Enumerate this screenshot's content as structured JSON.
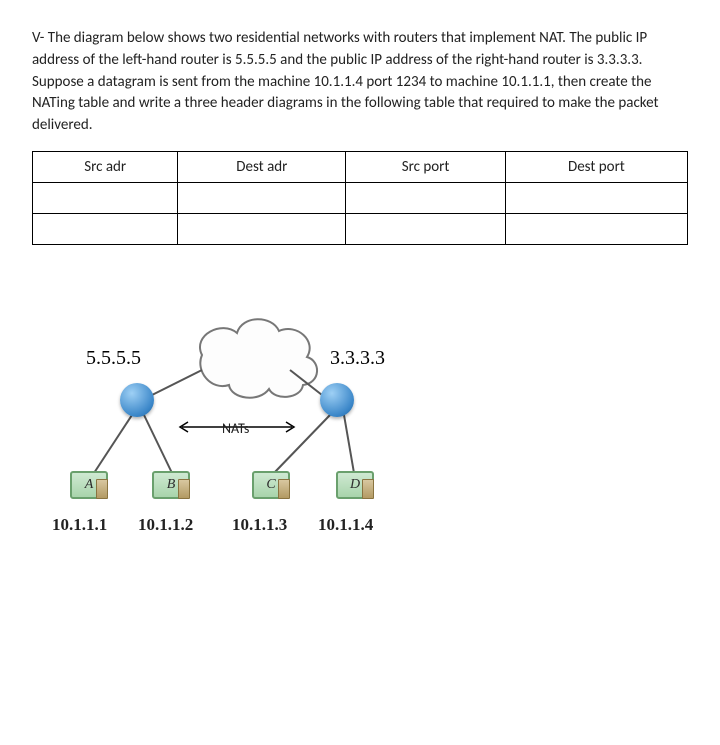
{
  "question": "V- The diagram below shows two residential networks with routers that implement NAT. The public IP address of the left-hand router is 5.5.5.5 and the public IP address of the right-hand router is 3.3.3.3. Suppose a datagram is sent from the machine 10.1.1.4 port 1234 to machine 10.1.1.1, then create the NATing table and write a three header diagrams in the following table that required to make the packet delivered.",
  "table": {
    "headers": [
      "Src adr",
      "Dest adr",
      "Src port",
      "Dest port"
    ],
    "rows": [
      [
        "",
        "",
        "",
        ""
      ],
      [
        "",
        "",
        "",
        ""
      ]
    ]
  },
  "diagram": {
    "left_public_ip": "5.5.5.5",
    "right_public_ip": "3.3.3.3",
    "link_label": "NATs",
    "hosts": [
      {
        "label": "A",
        "ip": "10.1.1.1"
      },
      {
        "label": "B",
        "ip": "10.1.1.2"
      },
      {
        "label": "C",
        "ip": "10.1.1.3"
      },
      {
        "label": "D",
        "ip": "10.1.1.4"
      }
    ]
  }
}
